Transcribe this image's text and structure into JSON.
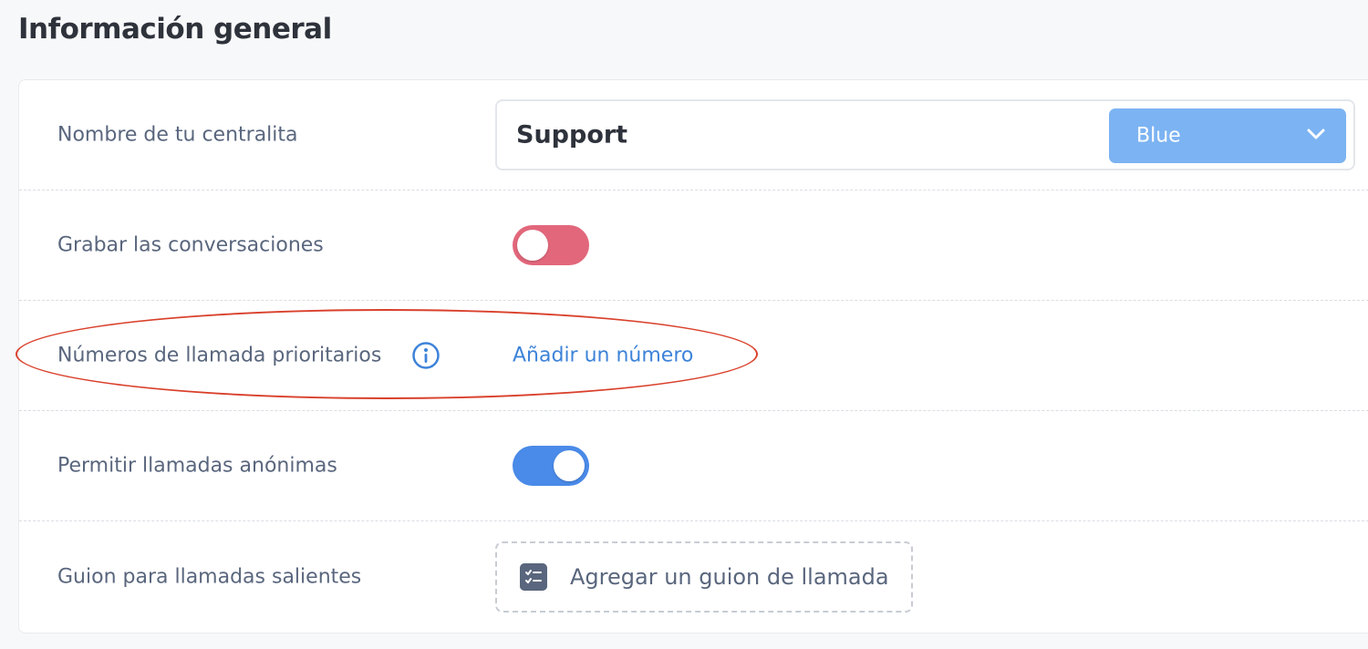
{
  "section": {
    "title": "Información general"
  },
  "rows": {
    "name": {
      "label": "Nombre de tu centralita",
      "value": "Support",
      "color_select": {
        "selected": "Blue",
        "color": "#7cb3f2",
        "icon": "chevron-down-icon"
      }
    },
    "record": {
      "label": "Grabar las conversaciones",
      "toggle_state": "off",
      "color": "#e2677b"
    },
    "priority": {
      "label": "Números de llamada prioritarios",
      "info_icon": "info-icon",
      "link": "Añadir un número"
    },
    "anonymous": {
      "label": "Permitir llamadas anónimas",
      "toggle_state": "on",
      "color": "#4a8ae8"
    },
    "script": {
      "label": "Guion para llamadas salientes",
      "button_label": "Agregar un guion de llamada",
      "button_icon": "checklist-icon"
    }
  },
  "annotation": {
    "shape": "ellipse",
    "color": "#d9402b"
  }
}
